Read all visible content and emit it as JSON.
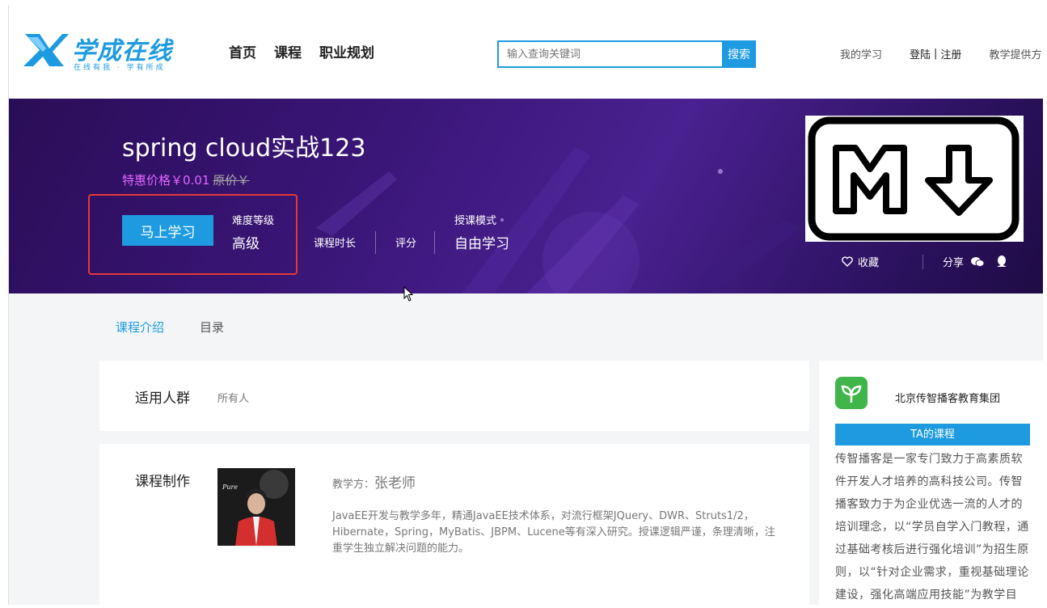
{
  "header": {
    "logo_title": "学成在线",
    "logo_subtitle": "在线有我 · 学有所成",
    "nav": [
      "首页",
      "课程",
      "职业规划"
    ],
    "search_placeholder": "输入查询关键词",
    "search_button": "搜索",
    "my_study": "我的学习",
    "login": "登陆",
    "separator": "|",
    "register": "注册",
    "teach": "教学提供方"
  },
  "banner": {
    "title": "spring cloud实战123",
    "price_label": "特惠价格￥0.01",
    "original_price": "原价￥",
    "study_button": "马上学习",
    "difficulty_label": "难度等级",
    "difficulty_value": "高级",
    "duration_label": "课程时长",
    "rating_label": "评分",
    "mode_label": "授课模式",
    "mode_value": "自由学习",
    "favorite": "收藏",
    "share": "分享",
    "colors": {
      "accent": "#1e9be0",
      "price": "#e066ff",
      "highlight": "#e53935"
    }
  },
  "tabs": [
    "课程介绍",
    "目录"
  ],
  "audience": {
    "title": "适用人群",
    "value": "所有人"
  },
  "production": {
    "title": "课程制作",
    "teacher_prefix": "教学方：",
    "teacher_name": "张老师",
    "bio": "JavaEE开发与教学多年，精通JavaEE技术体系，对流行框架JQuery、DWR、Struts1/2，Hibernate，Spring，MyBatis、JBPM、Lucene等有深入研究。授课逻辑严谨，条理清晰，注重学生独立解决问题的能力。",
    "avatar_text": "Pure"
  },
  "organization": {
    "name": "北京传智播客教育集团",
    "ta_button": "TA的课程",
    "description": "传智播客是一家专门致力于高素质软件开发人才培养的高科技公司。传智播客致力于为企业优选一流的人才的培训理念，以“学员自学入门教程，通过基础考核后进行强化培训”为招生原则，以“针对企业需求，重视基础理论建设，强化高端应用技能”为教学目标，以“高"
  }
}
